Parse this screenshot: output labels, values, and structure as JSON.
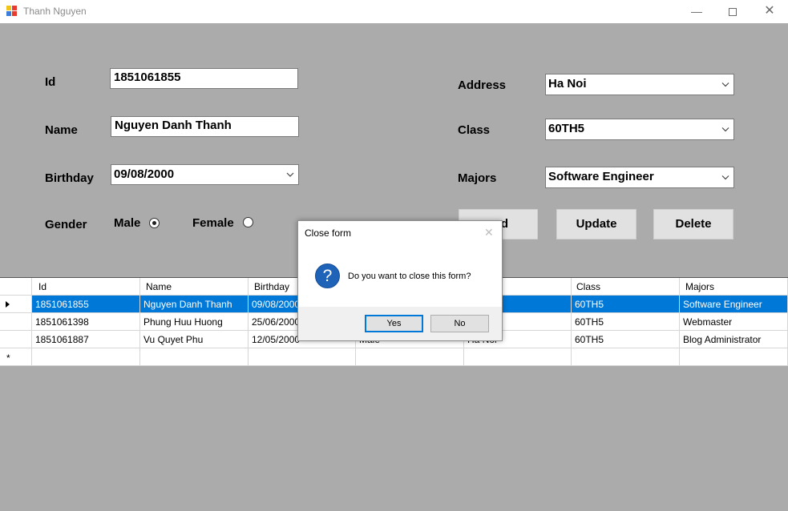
{
  "window": {
    "title": "Thanh Nguyen",
    "minimize": "—",
    "close": "✕"
  },
  "form": {
    "id_label": "Id",
    "id_value": "1851061855",
    "name_label": "Name",
    "name_value": "Nguyen Danh Thanh",
    "birthday_label": "Birthday",
    "birthday_value": "09/08/2000",
    "gender_label": "Gender",
    "gender_male": "Male",
    "gender_female": "Female",
    "gender_selected": "Male",
    "address_label": "Address",
    "address_value": "Ha Noi",
    "class_label": "Class",
    "class_value": "60TH5",
    "majors_label": "Majors",
    "majors_value": "Software Engineer"
  },
  "buttons": {
    "add_visible": "d",
    "update": "Update",
    "delete": "Delete"
  },
  "grid": {
    "columns": [
      "Id",
      "Name",
      "Birthday",
      "",
      "",
      "Class",
      "Majors"
    ],
    "rows": [
      {
        "id": "1851061855",
        "name": "Nguyen Danh Thanh",
        "birthday": "09/08/2000",
        "gender": "",
        "address": "",
        "class": "60TH5",
        "majors": "Software Engineer",
        "selected": true
      },
      {
        "id": "1851061398",
        "name": "Phung Huu Huong",
        "birthday": "25/06/2000",
        "gender": "",
        "address": "",
        "class": "60TH5",
        "majors": "Webmaster",
        "selected": false
      },
      {
        "id": "1851061887",
        "name": "Vu Quyet Phu",
        "birthday": "12/05/2000",
        "gender": "Male",
        "address": "Ha Noi",
        "class": "60TH5",
        "majors": "Blog Administrator",
        "selected": false
      }
    ],
    "new_row_marker": "*"
  },
  "dialog": {
    "title": "Close form",
    "close_glyph": "✕",
    "icon": "question-icon",
    "icon_glyph": "?",
    "message": "Do you want to close this form?",
    "yes": "Yes",
    "no": "No"
  },
  "colors": {
    "selection": "#0078d7",
    "form_background": "#ababab",
    "question_icon": "#1e63b8"
  }
}
